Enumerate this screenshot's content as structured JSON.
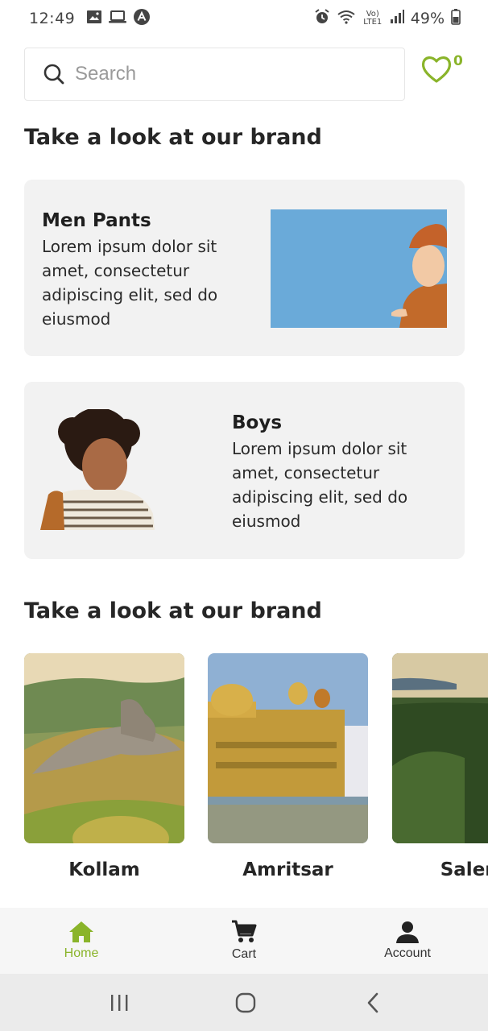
{
  "status_bar": {
    "time": "12:49",
    "battery": "49%",
    "network_label": "Vo) LTE1"
  },
  "search": {
    "placeholder": "Search"
  },
  "wishlist": {
    "count": "0",
    "accent": "#8ab42a"
  },
  "sections": [
    {
      "title": "Take a look at our brand"
    },
    {
      "title": "Take a look at our brand"
    }
  ],
  "brand_cards": [
    {
      "title": "Men Pants",
      "description": "Lorem ipsum dolor sit amet, consectetur adipiscing elit, sed do eiusmod"
    },
    {
      "title": "Boys",
      "description": "Lorem ipsum dolor sit amet, consectetur adipiscing elit, sed do eiusmod"
    }
  ],
  "places": [
    {
      "name": "Kollam"
    },
    {
      "name": "Amritsar"
    },
    {
      "name": "Salem"
    }
  ],
  "bottom_nav": {
    "items": [
      {
        "label": "Home",
        "icon": "home-icon",
        "active": true
      },
      {
        "label": "Cart",
        "icon": "cart-icon",
        "active": false
      },
      {
        "label": "Account",
        "icon": "account-icon",
        "active": false
      }
    ]
  }
}
